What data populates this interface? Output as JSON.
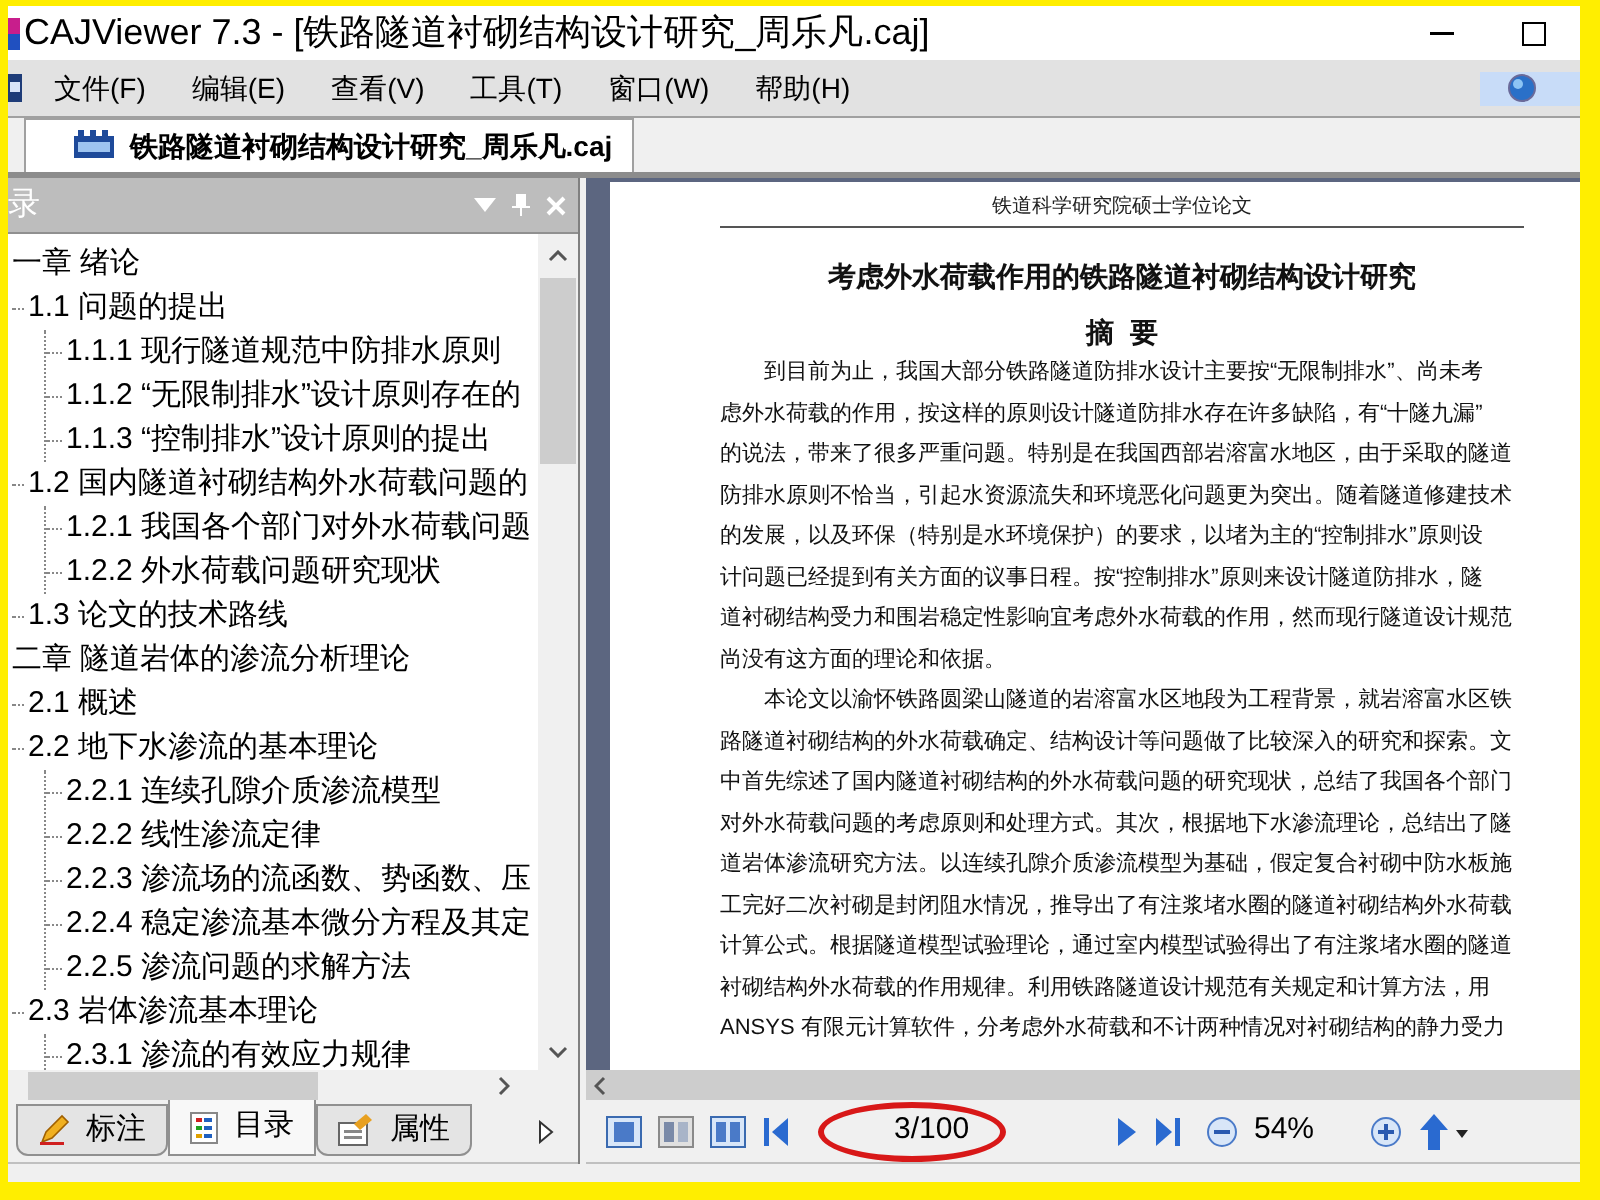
{
  "window": {
    "title": "CAJViewer 7.3 - [铁路隧道衬砌结构设计研究_周乐凡.caj]"
  },
  "menu": [
    "文件(F)",
    "编辑(E)",
    "查看(V)",
    "工具(T)",
    "窗口(W)",
    "帮助(H)"
  ],
  "document_tabs": [
    {
      "label": "铁路隧道衬砌结构设计研究_周乐凡.caj",
      "selected": true
    }
  ],
  "side_panel": {
    "title": "录",
    "tree": [
      {
        "label": "一章 绪论",
        "children": [
          {
            "label": "1.1 问题的提出",
            "children": [
              {
                "label": "1.1.1 现行隧道规范中防排水原则"
              },
              {
                "label": "1.1.2 “无限制排水”设计原则存在的"
              },
              {
                "label": "1.1.3 “控制排水”设计原则的提出"
              }
            ]
          },
          {
            "label": "1.2 国内隧道衬砌结构外水荷载问题的",
            "children": [
              {
                "label": "1.2.1 我国各个部门对外水荷载问题"
              },
              {
                "label": "1.2.2 外水荷载问题研究现状"
              }
            ]
          },
          {
            "label": "1.3 论文的技术路线"
          }
        ]
      },
      {
        "label": "二章 隧道岩体的渗流分析理论",
        "children": [
          {
            "label": "2.1 概述"
          },
          {
            "label": "2.2 地下水渗流的基本理论",
            "children": [
              {
                "label": "2.2.1 连续孔隙介质渗流模型"
              },
              {
                "label": "2.2.2 线性渗流定律"
              },
              {
                "label": "2.2.3 渗流场的流函数、势函数、压"
              },
              {
                "label": "2.2.4 稳定渗流基本微分方程及其定"
              },
              {
                "label": "2.2.5 渗流问题的求解方法"
              }
            ]
          },
          {
            "label": "2.3 岩体渗流基本理论",
            "children": [
              {
                "label": "2.3.1 渗流的有效应力规律"
              }
            ]
          }
        ]
      }
    ],
    "bottom_tabs": [
      {
        "label": "标注",
        "selected": false
      },
      {
        "label": "目录",
        "selected": true
      },
      {
        "label": "属性",
        "selected": false
      }
    ]
  },
  "page": {
    "running_header": "铁道科学研究院硕士学位论文",
    "title": "考虑外水荷载作用的铁路隧道衬砌结构设计研究",
    "heading": "摘  要",
    "paragraphs": [
      [
        "到目前为止，我国大部分铁路隧道防排水设计主要按“无限制排水”、尚未考",
        "虑外水荷载的作用，按这样的原则设计隧道防排水存在许多缺陷，有“十隧九漏”",
        "的说法，带来了很多严重问题。特别是在我国西部岩溶富水地区，由于采取的隧道",
        "防排水原则不恰当，引起水资源流失和环境恶化问题更为突出。随着隧道修建技术",
        "的发展，以及环保（特别是水环境保护）的要求，以堵为主的“控制排水”原则设",
        "计问题已经提到有关方面的议事日程。按“控制排水”原则来设计隧道防排水，隧",
        "道衬砌结构受力和围岩稳定性影响宜考虑外水荷载的作用，然而现行隧道设计规范",
        "尚没有这方面的理论和依据。"
      ],
      [
        "本论文以渝怀铁路圆梁山隧道的岩溶富水区地段为工程背景，就岩溶富水区铁",
        "路隧道衬砌结构的外水荷载确定、结构设计等问题做了比较深入的研究和探索。文",
        "中首先综述了国内隧道衬砌结构的外水荷载问题的研究现状，总结了我国各个部门",
        "对外水荷载问题的考虑原则和处理方式。其次，根据地下水渗流理论，总结出了隧",
        "道岩体渗流研究方法。以连续孔隙介质渗流模型为基础，假定复合衬砌中防水板施",
        "工完好二次衬砌是封闭阻水情况，推导出了有注浆堵水圈的隧道衬砌结构外水荷载",
        "计算公式。根据隧道模型试验理论，通过室内模型试验得出了有注浆堵水圈的隧道",
        "衬砌结构外水荷载的作用规律。利用铁路隧道设计规范有关规定和计算方法，用",
        "ANSYS 有限元计算软件，分考虑外水荷载和不计两种情况对衬砌结构的静力受力"
      ]
    ]
  },
  "toolbar": {
    "page_field": "3/100",
    "zoom": "54%"
  }
}
